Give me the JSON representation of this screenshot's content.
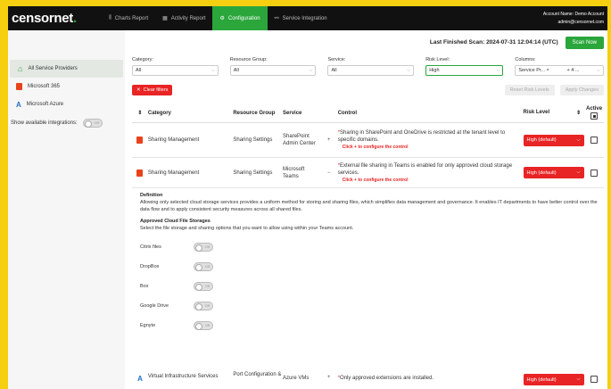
{
  "brand": {
    "name": "censornet",
    "dot": "."
  },
  "nav": [
    {
      "icon": "chart-icon",
      "glyph": "⫼",
      "label": "Charts Report"
    },
    {
      "icon": "activity-icon",
      "glyph": "▦",
      "label": "Activity Report"
    },
    {
      "icon": "gear-icon",
      "glyph": "⚙",
      "label": "Configuration"
    },
    {
      "icon": "link-icon",
      "glyph": "⚯",
      "label": "Service Integration"
    }
  ],
  "account": {
    "name": "Account Name: Demo Account",
    "email": "admin@censornet.com"
  },
  "scan": {
    "label": "Last Finished Scan: 2024-07-31 12:04:14 (UTC)",
    "button": "Scan Now"
  },
  "sidebar": {
    "items": [
      {
        "label": "All Service Providers"
      },
      {
        "label": "Microsoft 365"
      },
      {
        "label": "Microsoft Azure"
      }
    ],
    "toggle_label": "Show available integrations:",
    "toggle_state": "Off"
  },
  "filters": [
    {
      "label": "Category:",
      "value": "All"
    },
    {
      "label": "Resource Group:",
      "value": "All"
    },
    {
      "label": "Service:",
      "value": "All"
    },
    {
      "label": "Risk Level:",
      "value": "High"
    },
    {
      "label": "Columns:",
      "chip": "Service Pr...",
      "chip_x": "×",
      "more": "+ 4 ..."
    }
  ],
  "actions": {
    "clear": "Clear filters",
    "reset": "Reset Risk Levels",
    "apply": "Apply Changes"
  },
  "table": {
    "headers": {
      "sort": "⇕",
      "category": "Category",
      "resource_group": "Resource Group",
      "service": "Service",
      "control": "Control",
      "risk": "Risk Level",
      "risk_sort": "⇕",
      "active": "Active"
    },
    "rows": [
      {
        "category": "Sharing Management",
        "resource_group": "Sharing Settings",
        "service": "SharePoint Admin Center",
        "expand": "+",
        "star": "*",
        "control": "Sharing in SharePoint and OneDrive is restricted at the tenant level to specific domains.",
        "configure": "Click + to configure the control",
        "risk": "High (default)"
      },
      {
        "category": "Sharing Management",
        "resource_group": "Sharing Settings",
        "service": "Microsoft Teams",
        "expand": "−",
        "star": "*",
        "control": "External file sharing in Teams is enabled for only approved cloud storage services.",
        "configure": "Click + to configure the control",
        "risk": "High (default)"
      }
    ],
    "bottom_row": {
      "category": "Virtual Infrastructure Services",
      "resource_group": "Port Configuration &",
      "service": "Azure VMs",
      "expand": "+",
      "star": "*",
      "control": "Only approved extensions are installed.",
      "risk": "High (default)"
    }
  },
  "detail": {
    "definition_title": "Definition",
    "definition_text": "Allowing only selected cloud storage services provides a uniform method for storing and sharing files, which simplifies data management and governance. It enables IT departments to have better control over the data flow and to apply consistent security measures across all shared files.",
    "approved_title": "Approved Cloud File Storages",
    "approved_text": "Select the file storage and sharing options that you want to allow using within your Teams account.",
    "options": [
      {
        "label": "Citrix files",
        "state": "Off"
      },
      {
        "label": "DropBox",
        "state": "Off"
      },
      {
        "label": "Box",
        "state": "Off"
      },
      {
        "label": "Google Drive",
        "state": "Off"
      },
      {
        "label": "Egnyte",
        "state": "Off"
      }
    ]
  },
  "colors": {
    "accent": "#2aa63b",
    "danger": "#e82424",
    "frame": "#f5cf10"
  }
}
